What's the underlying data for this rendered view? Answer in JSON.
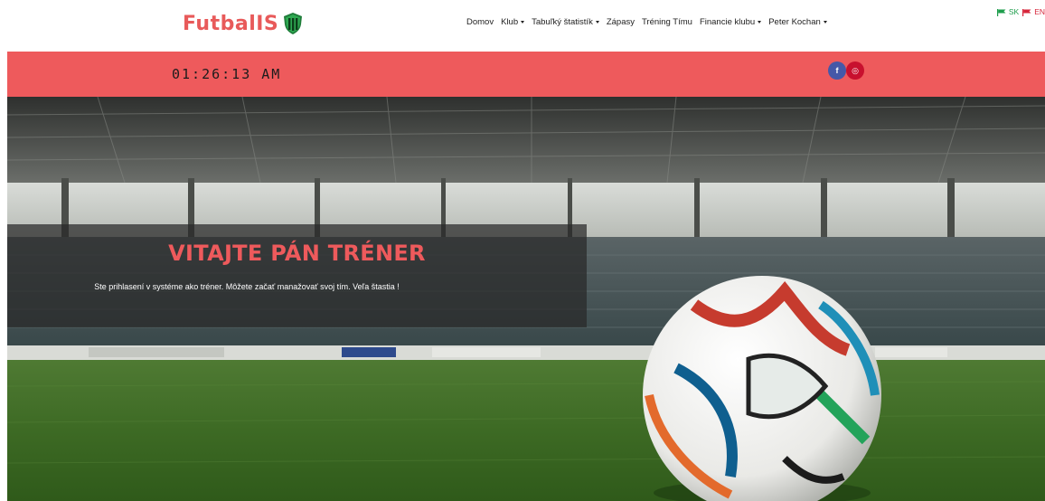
{
  "brand": {
    "name": "FutbalIS",
    "icon": "shield-logo-icon"
  },
  "nav": {
    "items": [
      {
        "label": "Domov",
        "dropdown": false
      },
      {
        "label": "Klub",
        "dropdown": true
      },
      {
        "label": "Tabuľký štatistík",
        "dropdown": true
      },
      {
        "label": "Zápasy",
        "dropdown": false
      },
      {
        "label": "Tréning Tímu",
        "dropdown": false
      },
      {
        "label": "Financie klubu",
        "dropdown": true
      },
      {
        "label": "Peter Kochan",
        "dropdown": true
      }
    ]
  },
  "lang": {
    "sk": {
      "label": "SK",
      "color": "#1e9d4c",
      "icon": "flag-icon"
    },
    "en": {
      "label": "EN",
      "color": "#d6253a",
      "icon": "flag-icon"
    }
  },
  "topbar": {
    "clock": "01:26:13 AM",
    "background": "#ee5a5c",
    "social": [
      {
        "name": "facebook-icon",
        "glyph": "f",
        "color": "#4558a8"
      },
      {
        "name": "instagram-icon",
        "glyph": "◎",
        "color": "#c8102e"
      }
    ]
  },
  "hero": {
    "title": "VITAJTE PÁN TRÉNER",
    "text": "Ste prihlasení v systéme ako tréner. Môžete začať manažovať svoj tím. Veľa štastia !"
  }
}
